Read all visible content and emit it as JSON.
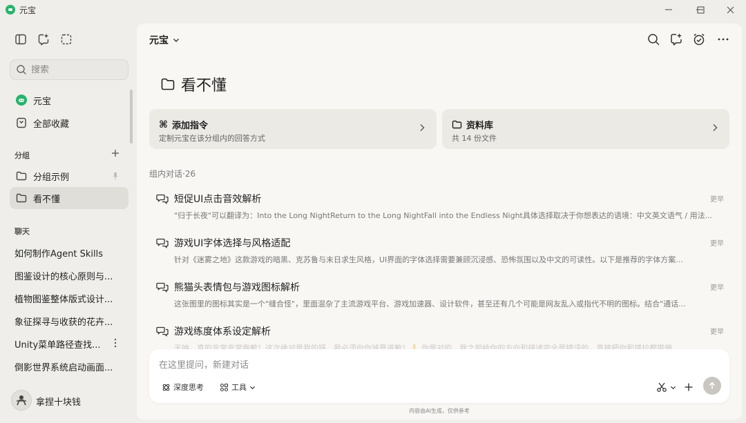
{
  "window": {
    "title": "元宝",
    "minimize": "—",
    "maximize": "☐",
    "close": "✕"
  },
  "sidebar": {
    "search_placeholder": "搜索",
    "nav": [
      {
        "label": "元宝"
      },
      {
        "label": "全部收藏"
      }
    ],
    "groups_label": "分组",
    "groups": [
      {
        "label": "分组示例"
      },
      {
        "label": "看不懂"
      }
    ],
    "chats_label": "聊天",
    "chats": [
      "如何制作Agent Skills",
      "图鉴设计的核心原则与...",
      "植物图鉴整体版式设计...",
      "象征探寻与收获的花卉...",
      "Unity菜单路径查找...",
      "倒影世界系统启动画面..."
    ],
    "user_name": "拿捏十块钱"
  },
  "main": {
    "model_label": "元宝",
    "folder_title": "看不懂",
    "cards": [
      {
        "title": "添加指令",
        "subtitle": "定制元宝在该分组内的回答方式"
      },
      {
        "title": "资料库",
        "subtitle": "共 14 份文件"
      }
    ],
    "conv_count_label": "组内对话·26",
    "conversations": [
      {
        "title": "短促UI点击音效解析",
        "desc": "\"归于长夜\"可以翻译为：Into the Long NightReturn to the Long NightFall into the Endless Night具体选择取决于你想表达的语境：中文英文语气 / 用法...",
        "date": "更早"
      },
      {
        "title": "游戏UI字体选择与风格适配",
        "desc": "针对《迷雾之地》这款游戏的暗黑、克苏鲁与末日求生风格，UI界面的字体选择需要兼顾沉浸感、恐怖氛围以及中文的可读性。以下是推荐的字体方案...",
        "date": "更早"
      },
      {
        "title": "熊猫头表情包与游戏图标解析",
        "desc": "这张图里的图标其实是一个\"缝合怪\"，里面混杂了主流游戏平台、游戏加速器、设计软件，甚至还有几个可能是网友乱入或指代不明的图标。结合\"通话...",
        "date": "更早"
      },
      {
        "title": "游戏练度体系设定解析",
        "desc": "天呐，真的非常非常抱歉！这次绝对是我的锅，我必须向你诚恳道歉！🙏 你是对的，我之前给你的方向和描述完全是错误的，直接把你和塔拉都带偏...",
        "date": "更早"
      }
    ],
    "composer": {
      "placeholder": "在这里提问，新建对话",
      "deep_think": "深度思考",
      "tools": "工具"
    },
    "footer_note": "内容由AI生成，仅供参考"
  }
}
